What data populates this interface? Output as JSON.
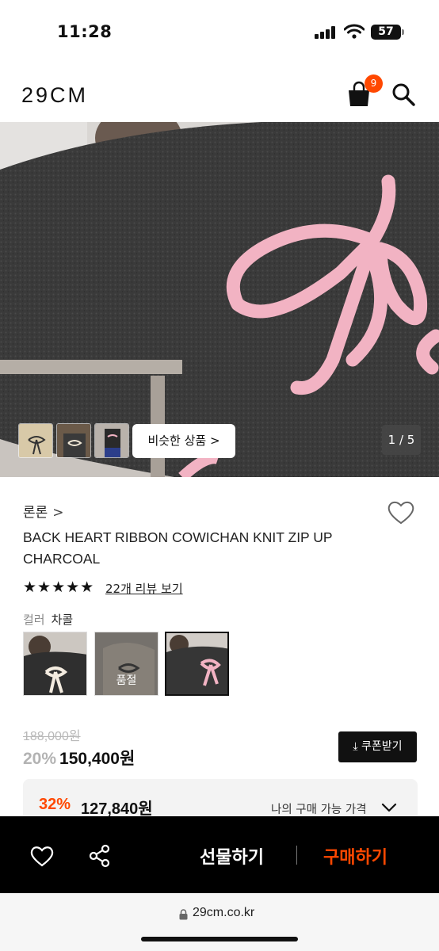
{
  "status_bar": {
    "time": "11:28",
    "battery": "57"
  },
  "header": {
    "logo": "29CM",
    "cart_count": "9"
  },
  "hero": {
    "similar_products_label": "비슷한 상품 >",
    "page_counter": "1 / 5"
  },
  "product": {
    "brand": "론론",
    "brand_chevron": ">",
    "name": "BACK HEART RIBBON COWICHAN KNIT ZIP UP CHARCOAL",
    "stars": "★★★★★",
    "review_link": "22개 리뷰 보기",
    "color_label": "컬러",
    "color_value": "차콜",
    "swatches": [
      {
        "name": "color-option-1"
      },
      {
        "name": "color-option-2",
        "badge": "품절"
      },
      {
        "name": "color-option-3"
      }
    ]
  },
  "pricing": {
    "original_price": "188,000원",
    "discount": "20%",
    "sale_price": "150,400원",
    "coupon_button": "⤓ 쿠폰받기",
    "my_discount": "32%",
    "my_price": "127,840원",
    "my_price_label": "나의 구매 가능 가격"
  },
  "action_bar": {
    "gift_label": "선물하기",
    "buy_label": "구매하기"
  },
  "browser": {
    "url": "29cm.co.kr"
  },
  "colors": {
    "accent": "#ff4800",
    "action_bar_bg": "#000000",
    "knit_charcoal": "#3b3b3b",
    "ribbon_pink": "#f2b3c3"
  }
}
